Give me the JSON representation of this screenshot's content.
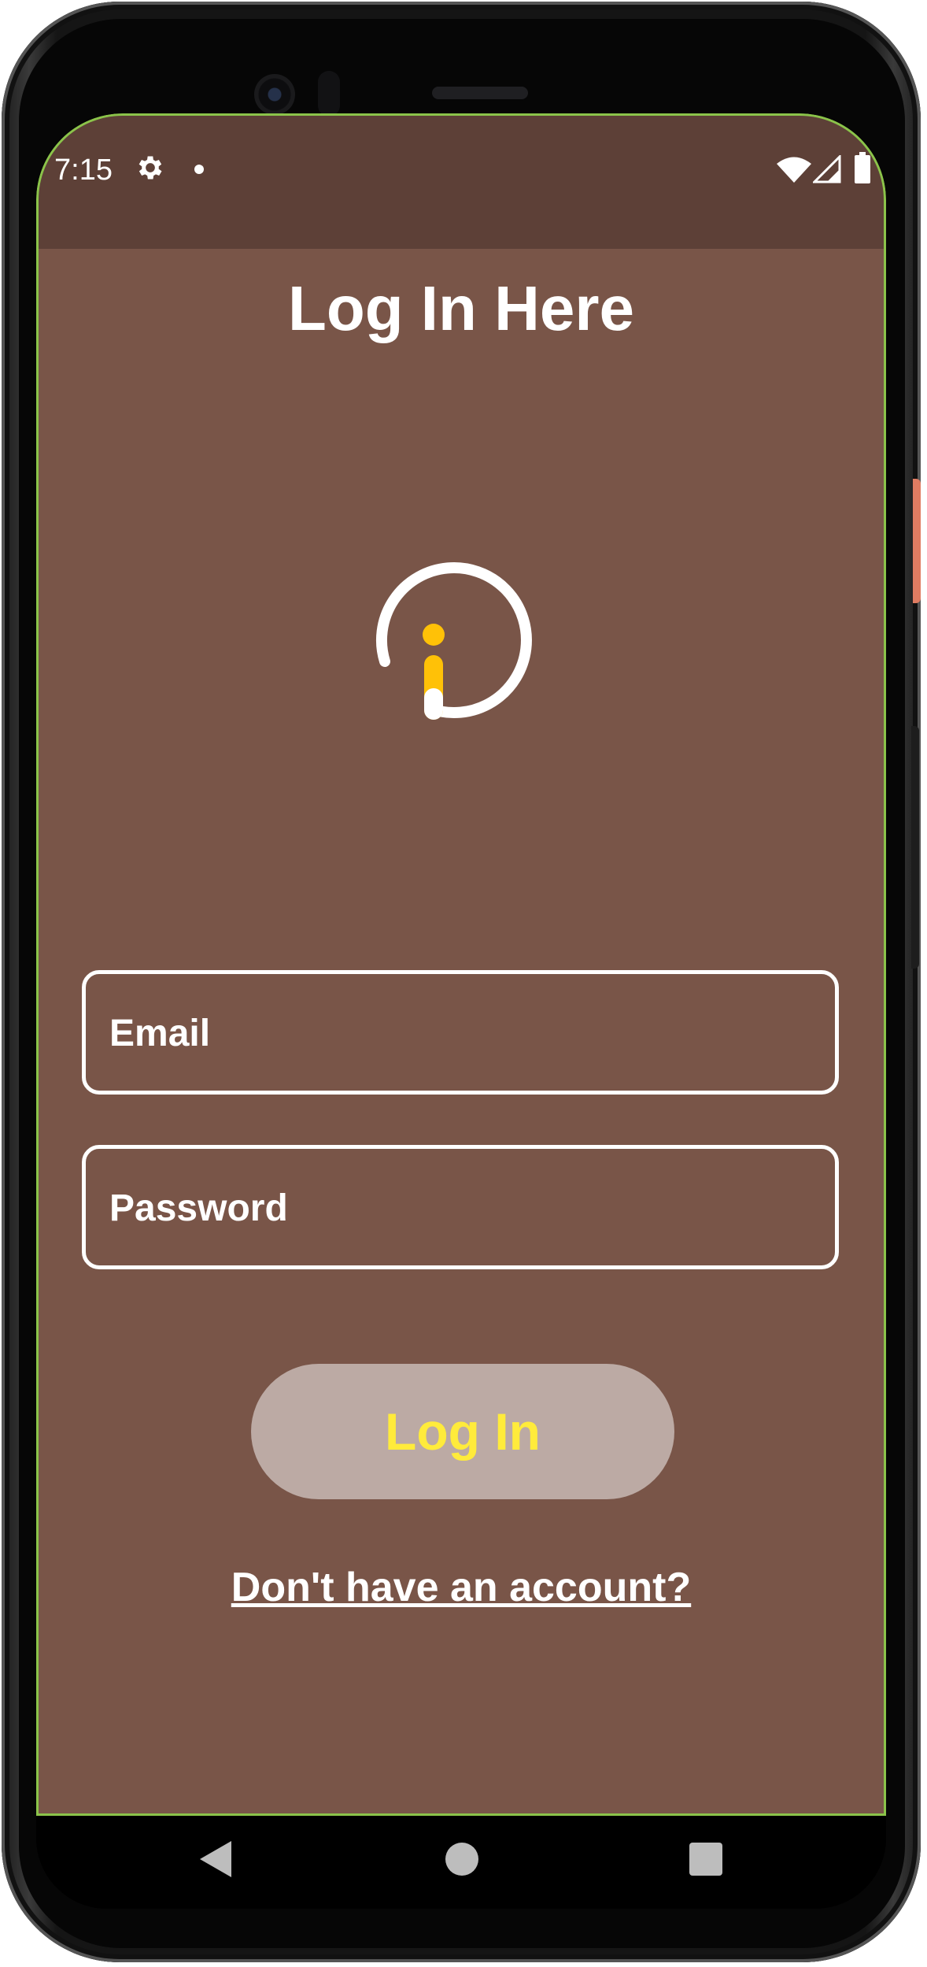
{
  "status_bar": {
    "time": "7:15",
    "icons": [
      "gear-icon",
      "notification-dot-icon",
      "wifi-icon",
      "signal-icon",
      "battery-icon"
    ]
  },
  "login_screen": {
    "title": "Log In Here",
    "logo_icon": "info-logo-icon",
    "email_placeholder": "Email",
    "password_placeholder": "Password",
    "login_button": "Log In",
    "signup_link": "Don't have an account?"
  },
  "nav_bar": {
    "icons": [
      "back-icon",
      "home-icon",
      "recents-icon"
    ]
  },
  "colors": {
    "status_bar_bg": "#5d4037",
    "app_bg": "#795548",
    "button_bg": "#bcaaa4",
    "button_text": "#ffeb3b",
    "logo_accent": "#ffc107",
    "outline": "#8bc34a"
  }
}
